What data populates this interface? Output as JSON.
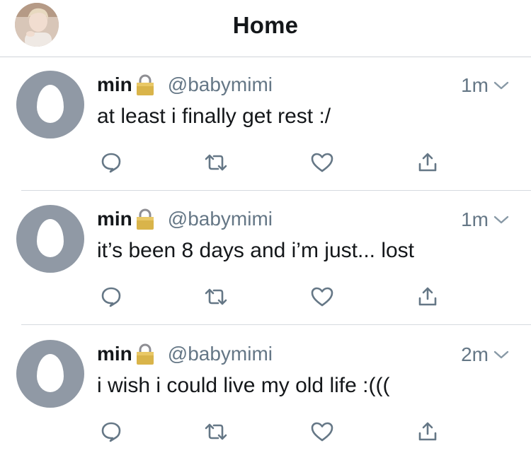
{
  "header": {
    "title": "Home",
    "avatar_icon": "profile-photo"
  },
  "colors": {
    "text": "#14171a",
    "secondary": "#657786",
    "egg_avatar_bg": "#9099a5",
    "divider": "#d6dadf"
  },
  "tweets": [
    {
      "name": "min",
      "protected_icon": "lock-icon",
      "handle": "@babymimi",
      "time": "1m",
      "text": "at least i finally get rest :/"
    },
    {
      "name": "min",
      "protected_icon": "lock-icon",
      "handle": "@babymimi",
      "time": "1m",
      "text": "it’s been 8 days and i’m just... lost"
    },
    {
      "name": "min",
      "protected_icon": "lock-icon",
      "handle": "@babymimi",
      "time": "2m",
      "text": "i wish i could live my old life :((("
    }
  ],
  "actions": [
    "reply-icon",
    "retweet-icon",
    "like-icon",
    "share-icon"
  ]
}
